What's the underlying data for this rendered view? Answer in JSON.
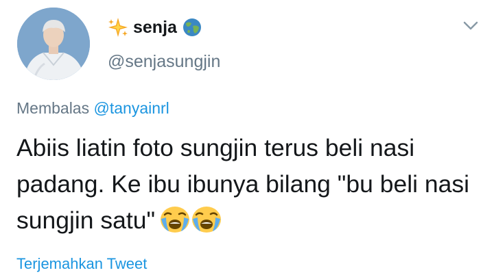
{
  "user": {
    "display_name": "senja",
    "handle": "@senjasungjin",
    "name_prefix_icon": "sparkle-emoji-icon",
    "name_suffix_icon": "globe-emoji-icon"
  },
  "reply": {
    "prefix": "Membalas",
    "target": "@tanyainrl"
  },
  "tweet": {
    "text": "Abiis liatin foto sungjin terus beli nasi padang. Ke ibu ibunya bilang \"bu beli nasi sungjin satu\"",
    "trailing_emoji": [
      "loudly-crying-face-icon",
      "loudly-crying-face-icon"
    ]
  },
  "actions": {
    "translate_label": "Terjemahkan Tweet",
    "menu_icon": "chevron-down-icon"
  },
  "colors": {
    "text": "#14171a",
    "secondary": "#657786",
    "link": "#1b95e0",
    "background": "#ffffff"
  }
}
